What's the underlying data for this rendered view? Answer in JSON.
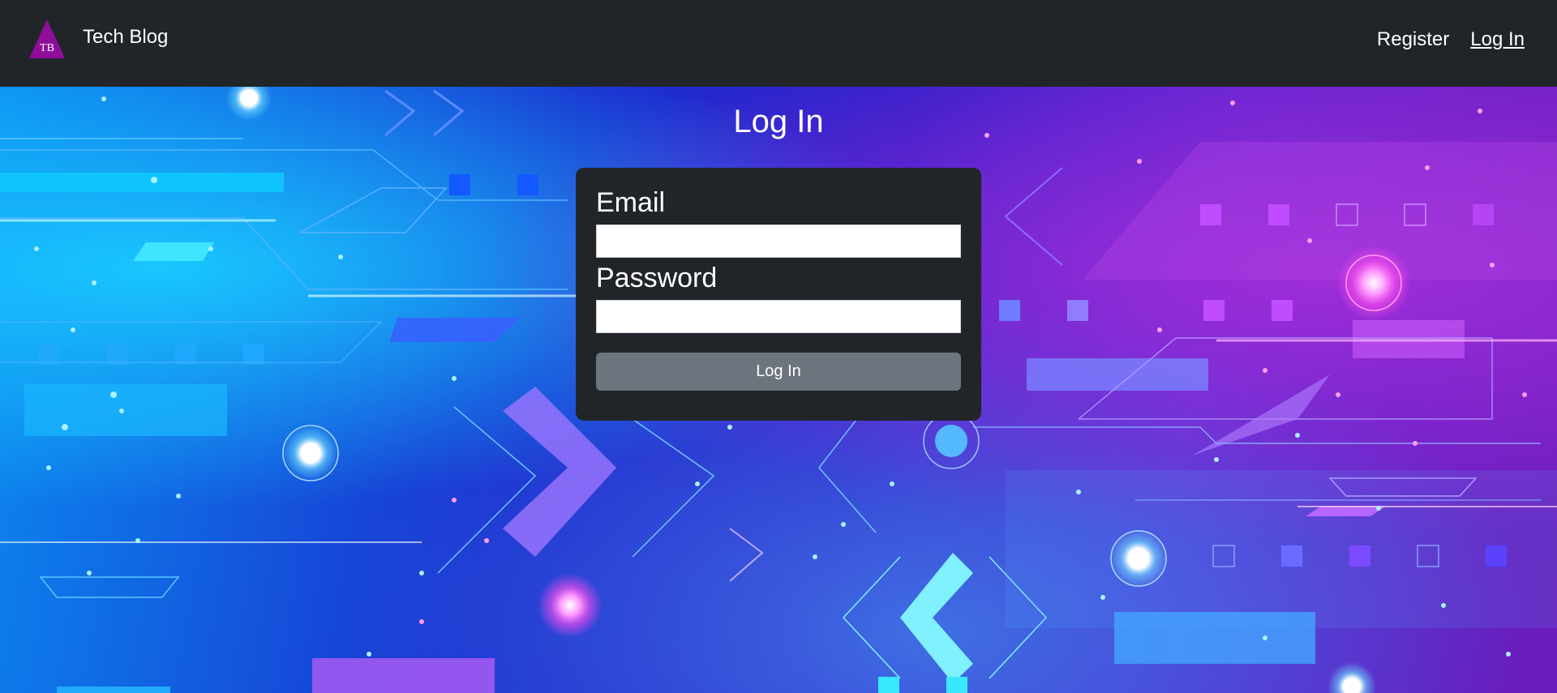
{
  "navbar": {
    "logo_text": "TB",
    "brand": "Tech Blog",
    "links": [
      {
        "label": "Register",
        "active": false
      },
      {
        "label": "Log In",
        "active": true
      }
    ]
  },
  "page": {
    "title": "Log In"
  },
  "login_form": {
    "email_label": "Email",
    "email_value": "",
    "password_label": "Password",
    "password_value": "",
    "submit_label": "Log In"
  },
  "colors": {
    "navbar_bg": "#212529",
    "logo_fill": "#8e0e9a",
    "button_bg": "#6c757d"
  }
}
